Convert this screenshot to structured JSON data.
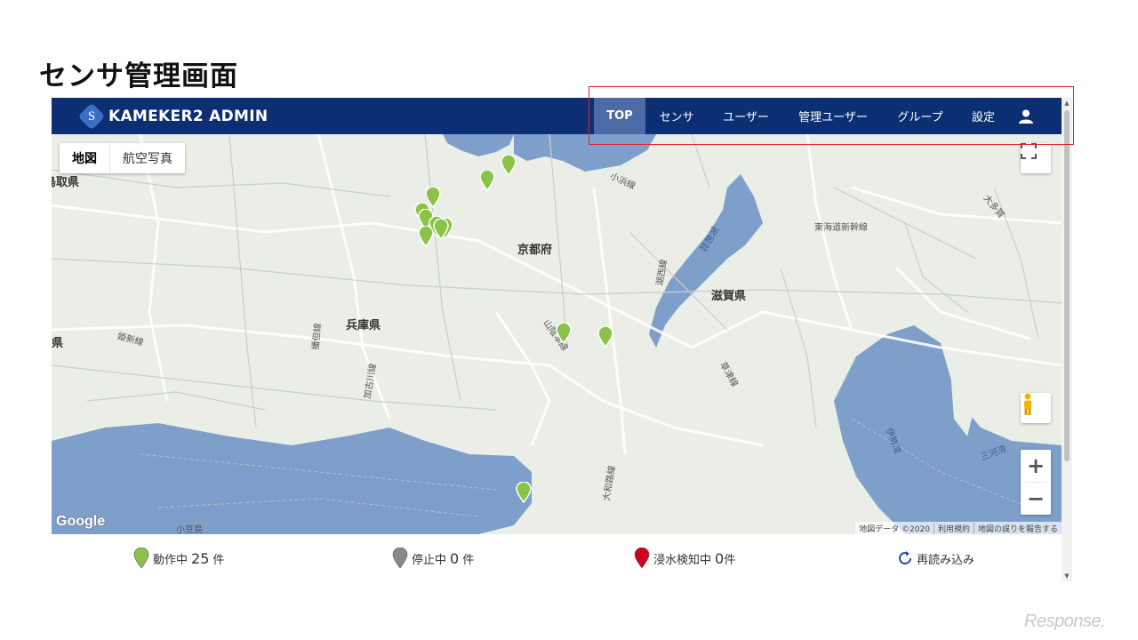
{
  "slide_title": "センサ管理画面",
  "brand": {
    "logo_letter": "S",
    "name": "KAMEKER2 ADMIN"
  },
  "nav": {
    "items": [
      {
        "label": "TOP",
        "active": true
      },
      {
        "label": "センサ"
      },
      {
        "label": "ユーザー"
      },
      {
        "label": "管理ユーザー"
      },
      {
        "label": "グループ"
      },
      {
        "label": "設定"
      }
    ],
    "user_icon": "person-icon"
  },
  "map": {
    "type_buttons": [
      "地図",
      "航空写真"
    ],
    "labels": {
      "kyoto": "京都府",
      "shiga": "滋賀県",
      "hyogo": "兵庫県",
      "tottori": "鳥取県",
      "okayama": "県",
      "shodoshima": "小豆島",
      "tokaido": "東海道新幹線",
      "obama": "小浜線",
      "kosei": "湖西線",
      "biwako": "琵琶湖",
      "sanin": "山陰本線",
      "kakogawa": "加古川線",
      "bantan": "播但線",
      "himeji": "姫新線",
      "kusatsu": "草津線",
      "yamato": "大和路線",
      "ise": "伊勢湾",
      "mikawa": "三河湾",
      "taga": "大多賀"
    },
    "google": "Google",
    "attribution": [
      "地図データ ©2020",
      "利用規約",
      "地図の誤りを報告する"
    ],
    "marker_color": "#8bc34a"
  },
  "status": {
    "running": {
      "label": "動作中",
      "count": "25",
      "unit": "件",
      "color": "#8bc34a"
    },
    "stopped": {
      "label": "停止中",
      "count": "0",
      "unit": "件",
      "color": "#888888"
    },
    "flood": {
      "label": "浸水検知中",
      "count": "0",
      "unit": "件",
      "color": "#d0021b"
    },
    "reload_label": "再読み込み"
  },
  "watermark": "Response."
}
